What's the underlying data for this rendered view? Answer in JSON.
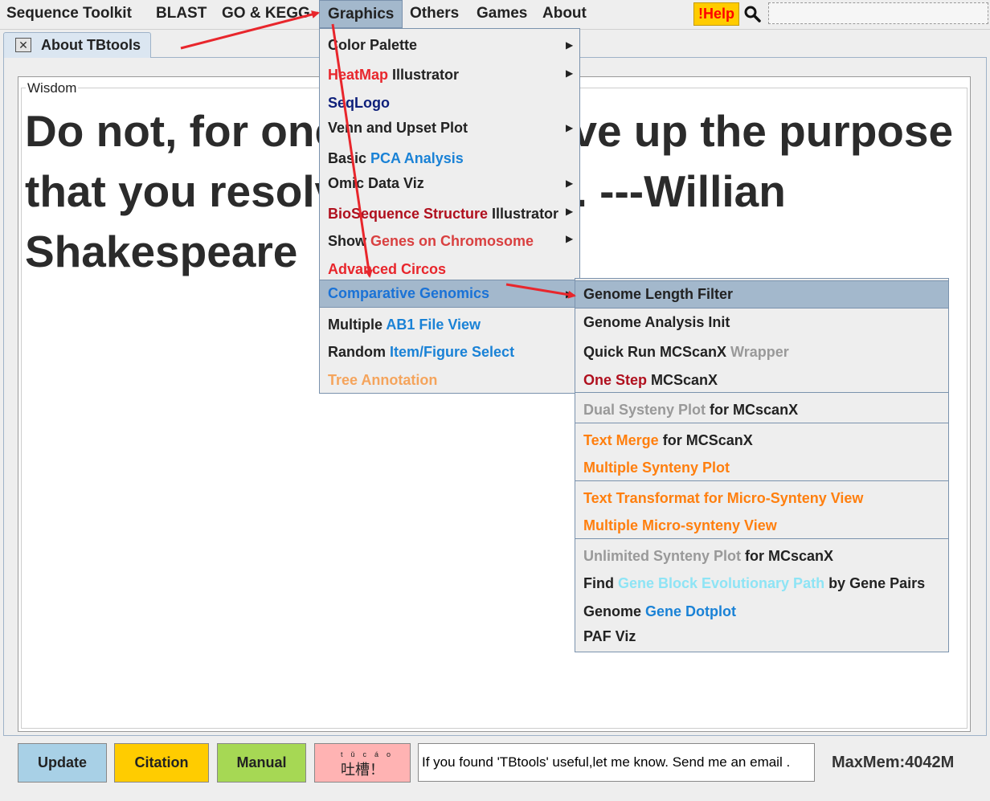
{
  "menubar": {
    "items": [
      {
        "label": "Sequence Toolkit"
      },
      {
        "label": "BLAST"
      },
      {
        "label": "GO & KEGG"
      },
      {
        "label": "Graphics"
      },
      {
        "label": "Others"
      },
      {
        "label": "Games"
      },
      {
        "label": "About"
      }
    ],
    "help_label": "!Help",
    "search_icon": "search-icon"
  },
  "tab": {
    "label": "About TBtools",
    "close_symbol": "✕"
  },
  "wisdom": {
    "legend": "Wisdom",
    "quote": "Do not, for one repulse, give up the purpose that you resolved to effect. ---Willian Shakespeare"
  },
  "graphics_menu": {
    "color_palette": "Color Palette",
    "heatmap_a": "HeatMap",
    "heatmap_b": " Illustrator",
    "seqlogo": "SeqLogo",
    "venn": "Venn and Upset Plot",
    "pca_a": "Basic ",
    "pca_b": "PCA Analysis",
    "omic": "Omic Data Viz",
    "bioseq_a": "BioSequence Structure",
    "bioseq_b": " Illustrator",
    "showgenes_a": "Show ",
    "showgenes_b": "Genes on Chromosome",
    "circos": "Advanced Circos",
    "comparative": "Comparative Genomics",
    "ab1_a": "Multiple ",
    "ab1_b": "AB1 File View",
    "random_a": "Random ",
    "random_b": "Item/Figure Select",
    "tree": "Tree Annotation"
  },
  "comparative_submenu": {
    "length_filter": "Genome Length Filter",
    "analysis_init": "Genome Analysis Init",
    "quick_a": "Quick Run MCScanX ",
    "quick_b": "Wrapper",
    "onestep_a": "One Step",
    "onestep_b": " MCScanX",
    "dual_a": "Dual Systeny Plot",
    "dual_b": " for MCscanX",
    "textmerge_a": "Text Merge",
    "textmerge_b": " for MCScanX",
    "multi_synteny": "Multiple Synteny Plot",
    "text_transformat": "Text Transformat for Micro-Synteny View",
    "multi_micro": "Multiple Micro-synteny View",
    "unlimited_a": "Unlimited Synteny Plot",
    "unlimited_b": " for MCscanX",
    "find_a": "Find ",
    "find_b": "Gene Block Evolutionary Path",
    "find_c": " by Gene Pairs",
    "dotplot_a": "Genome ",
    "dotplot_b": "Gene Dotplot",
    "paf": "PAF Viz"
  },
  "footer": {
    "update": "Update",
    "citation": "Citation",
    "manual": "Manual",
    "tucao_pinyin_1": "tǔ",
    "tucao_pinyin_2": "cáo",
    "tucao": "吐槽！",
    "status": "If you found 'TBtools' useful,let me know. Send me an email . ",
    "maxmem": "MaxMem:4042M"
  },
  "colors": {
    "update_bg": "#a8d0e6",
    "citation_bg": "#ffcc00",
    "manual_bg": "#a6d854",
    "tucao_bg": "#ffb3b3",
    "highlight": "#a3b8cc",
    "annotation_arrow": "#e8262c"
  }
}
